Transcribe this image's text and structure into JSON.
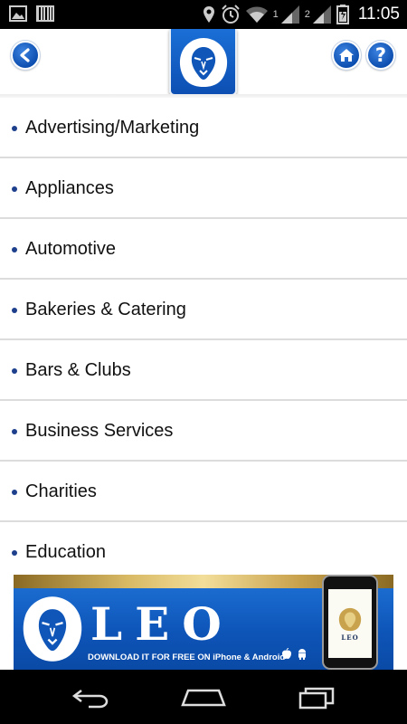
{
  "status_bar": {
    "time": "11:05",
    "sim1_label": "1",
    "sim2_label": "2",
    "icons": [
      "image-icon",
      "barcode-icon",
      "location-icon",
      "alarm-icon",
      "wifi-icon",
      "signal-icon",
      "battery-icon"
    ]
  },
  "header": {
    "back_icon": "back-arrow-icon",
    "home_icon": "home-icon",
    "help_label": "?",
    "logo": "lion-logo"
  },
  "categories": [
    "Advertising/Marketing",
    "Appliances",
    "Automotive",
    "Bakeries & Catering",
    "Bars & Clubs",
    "Business Services",
    "Charities",
    "Education"
  ],
  "banner": {
    "title": "LEO",
    "tagline": "DOWNLOAD IT FOR FREE ON iPhone & Android",
    "phone_text": "LEO"
  },
  "colors": {
    "accent_blue": "#0d4fb3",
    "bullet": "#1d3f8c",
    "gold": "#d8b964"
  }
}
